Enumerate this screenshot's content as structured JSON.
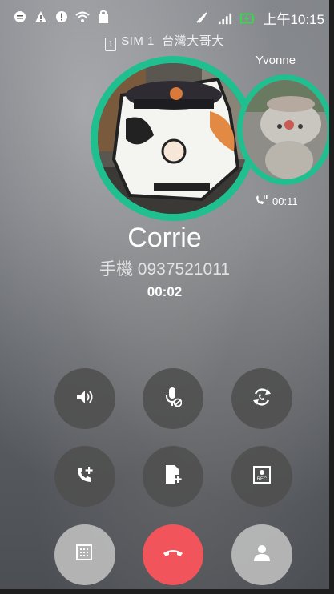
{
  "status_bar": {
    "time": "上午10:15",
    "icons": [
      "message-icon",
      "warning-icon",
      "alert-icon",
      "wifi-icon",
      "bag-icon",
      "mute-icon",
      "signal-icon",
      "battery-charging-icon"
    ]
  },
  "sim": {
    "slot": "SIM 1",
    "carrier": "台灣大哥大"
  },
  "second_call": {
    "name": "Yvonne",
    "hold_time": "00:11"
  },
  "caller": {
    "name": "Corrie",
    "label": "手機",
    "number": "0937521011",
    "duration": "00:02"
  },
  "colors": {
    "accent_ring": "#1fbf8f",
    "end_call": "#f2545b"
  },
  "controls": {
    "row1": [
      "speaker-icon",
      "mute-mic-icon",
      "swap-call-icon"
    ],
    "row2": [
      "add-call-icon",
      "add-note-icon",
      "record-icon"
    ],
    "row3": [
      "dialpad-icon",
      "end-call-icon",
      "contact-icon"
    ]
  }
}
